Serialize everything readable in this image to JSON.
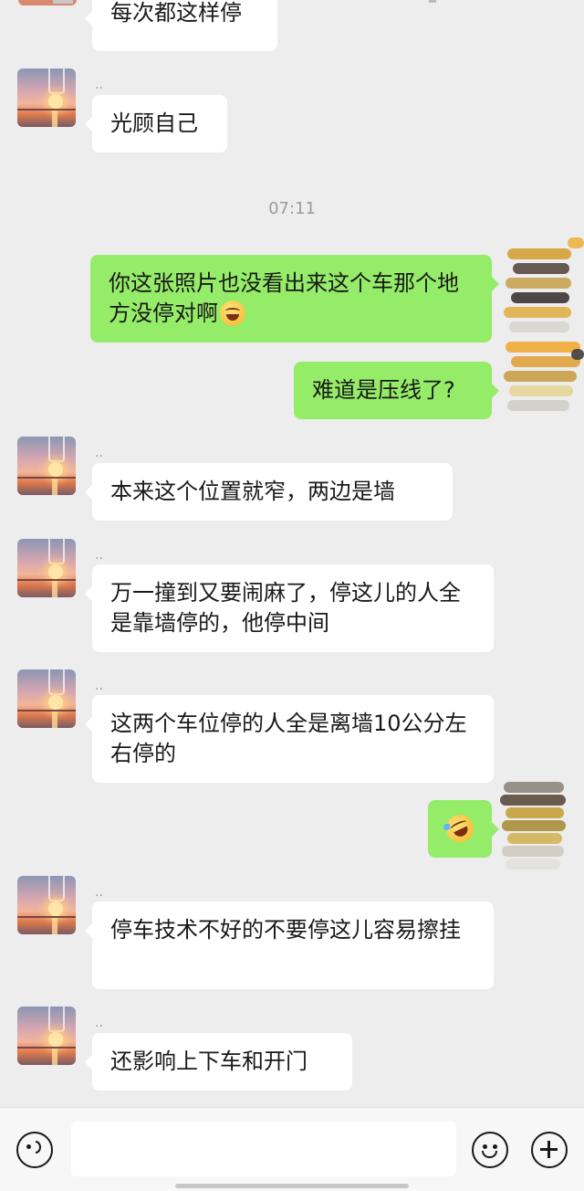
{
  "colors": {
    "background": "#ededed",
    "incoming_bubble": "#ffffff",
    "outgoing_bubble": "#95ec69",
    "timestamp": "#9b9b9b"
  },
  "messages": [
    {
      "direction": "incoming",
      "sender": "..",
      "text": "每次都这样停",
      "partial": true
    },
    {
      "direction": "incoming",
      "sender": "..",
      "text": "光顾自己"
    },
    {
      "type": "timestamp",
      "text": "07:11"
    },
    {
      "direction": "outgoing",
      "text": "你这张照片也没看出来这个车那个地方没停对啊",
      "emoji": "laughing-emoji"
    },
    {
      "direction": "outgoing",
      "text": "难道是压线了?"
    },
    {
      "direction": "incoming",
      "sender": "..",
      "text": "本来这个位置就窄，两边是墙"
    },
    {
      "direction": "incoming",
      "sender": "..",
      "text": "万一撞到又要闹麻了，停这儿的人全是靠墙停的，他停中间"
    },
    {
      "direction": "incoming",
      "sender": "..",
      "text": "这两个车位停的人全是离墙10公分左右停的"
    },
    {
      "direction": "outgoing",
      "text": "",
      "emoji": "rolling-laughing-emoji"
    },
    {
      "direction": "incoming",
      "sender": "..",
      "text": "停车技术不好的不要停这儿容易擦挂"
    },
    {
      "direction": "incoming",
      "sender": "..",
      "text": "还影响上下车和开门"
    }
  ],
  "input_bar": {
    "voice_icon": "voice-icon",
    "text_value": "",
    "emoji_icon": "emoji-icon",
    "plus_icon": "plus-icon"
  }
}
